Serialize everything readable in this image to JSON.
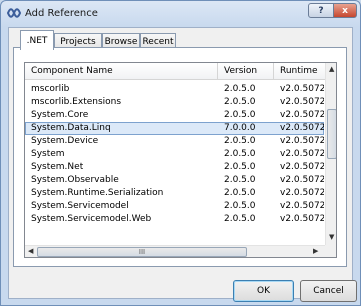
{
  "window": {
    "title": "Add Reference",
    "help_label": "?",
    "close_label": "x"
  },
  "tabs": [
    {
      "label": ".NET",
      "selected": true
    },
    {
      "label": "Projects",
      "selected": false
    },
    {
      "label": "Browse",
      "selected": false
    },
    {
      "label": "Recent",
      "selected": false
    }
  ],
  "list": {
    "columns": [
      "Component Name",
      "Version",
      "Runtime"
    ],
    "rows": [
      {
        "name": "mscorlib",
        "version": "2.0.5.0",
        "runtime": "v2.0.5072"
      },
      {
        "name": "mscorlib.Extensions",
        "version": "2.0.5.0",
        "runtime": "v2.0.5072"
      },
      {
        "name": "System.Core",
        "version": "2.0.5.0",
        "runtime": "v2.0.5072"
      },
      {
        "name": "System.Data.Linq",
        "version": "7.0.0.0",
        "runtime": "v2.0.5072",
        "selected": true
      },
      {
        "name": "System.Device",
        "version": "2.0.5.0",
        "runtime": "v2.0.5072"
      },
      {
        "name": "System",
        "version": "2.0.5.0",
        "runtime": "v2.0.5072"
      },
      {
        "name": "System.Net",
        "version": "2.0.5.0",
        "runtime": "v2.0.5072"
      },
      {
        "name": "System.Observable",
        "version": "2.0.5.0",
        "runtime": "v2.0.5072"
      },
      {
        "name": "System.Runtime.Serialization",
        "version": "2.0.5.0",
        "runtime": "v2.0.5072"
      },
      {
        "name": "System.Servicemodel",
        "version": "2.0.5.0",
        "runtime": "v2.0.5072"
      },
      {
        "name": "System.Servicemodel.Web",
        "version": "2.0.5.0",
        "runtime": "v2.0.5072"
      }
    ],
    "hscroll_grip": "III"
  },
  "buttons": {
    "ok": "OK",
    "cancel": "Cancel"
  },
  "colors": {
    "selection": "#dce9f8",
    "selection_border": "#7da2ce"
  }
}
